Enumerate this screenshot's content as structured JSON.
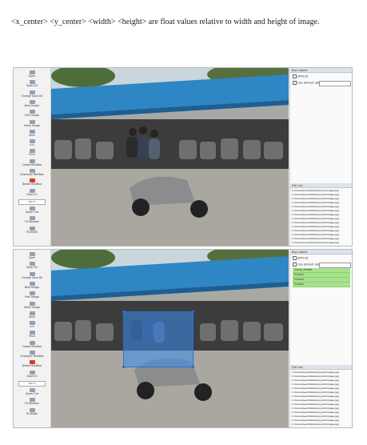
{
  "caption": "<x_center> <y_center> <width> <height> are float values relative to width and height of image.",
  "toolbar": {
    "items": [
      {
        "label": "Open",
        "icon": "folder-icon"
      },
      {
        "label": "Open Dir",
        "icon": "folder-open-icon"
      },
      {
        "label": "Change Save Dir",
        "icon": "folder-save-icon"
      },
      {
        "label": "Next Image",
        "icon": "arrow-right-icon"
      },
      {
        "label": "Prev Image",
        "icon": "arrow-left-icon"
      },
      {
        "label": "Verify Image",
        "icon": "verify-icon"
      },
      {
        "label": "Save",
        "icon": "save-icon"
      },
      {
        "label": "</>",
        "icon": "format-icon"
      },
      {
        "label": "YOLO",
        "icon": "yolo-icon"
      },
      {
        "label": "Create RectBox",
        "icon": "create-box-icon"
      },
      {
        "label": "Duplicate RectBox",
        "icon": "duplicate-box-icon"
      },
      {
        "label": "Delete RectBox",
        "icon": "delete-icon"
      },
      {
        "label": "Zoom In",
        "icon": "zoom-in-icon"
      }
    ],
    "zoom_value": "100 %",
    "bottom_items": [
      {
        "label": "Zoom Out",
        "icon": "zoom-out-icon"
      },
      {
        "label": "Fit Window",
        "icon": "fit-window-icon"
      },
      {
        "label": "Fit Width",
        "icon": "fit-width-icon"
      }
    ]
  },
  "panel": {
    "box_labels_title": "Box Labels",
    "edit_label": "Edit Label",
    "difficult": "difficult",
    "use_default_label": "Use default label",
    "file_list_title": "File List",
    "files": [
      "C:\\Users\\Asus\\Desktop\\yolo\\images.jpg",
      "C:\\Users\\Asus\\Desktop\\yolo\\images.jpg",
      "C:\\Users\\Asus\\Desktop\\yolo\\images.jpg",
      "C:\\Users\\Asus\\Desktop\\yolo\\images.jpg",
      "C:\\Users\\Asus\\Desktop\\yolo\\images.jpg",
      "C:\\Users\\Asus\\Desktop\\yolo\\images.jpg",
      "C:\\Users\\Asus\\Desktop\\yolo\\images.jpg",
      "C:\\Users\\Asus\\Desktop\\yolo\\images.jpg",
      "C:\\Users\\Asus\\Desktop\\yolo\\images.jpg",
      "C:\\Users\\Asus\\Desktop\\yolo\\images.jpg",
      "C:\\Users\\Asus\\Desktop\\yolo\\images.jpg",
      "C:\\Users\\Asus\\Desktop\\yolo\\images.jpg",
      "C:\\Users\\Asus\\Desktop\\yolo\\images.jpg",
      "C:\\Users\\Asus\\Desktop\\yolo\\images.jpg",
      "C:\\Users\\Asus\\Desktop\\yolo\\images.jpg",
      "C:\\Users\\Asus\\Desktop\\yolo\\images.jpg",
      "C:\\Users\\Asus\\Desktop\\yolo\\images.jpg",
      "C:\\Users\\Asus\\Desktop\\yolo\\images.jpg"
    ],
    "labels": [
      "Three_Seater",
      "Human",
      "Human",
      "Human"
    ]
  },
  "colors": {
    "roof": "#2f86c4",
    "selection_box": "#3c8cf0",
    "label_highlight": "#a9e28c",
    "delete_icon": "#d93a2b"
  }
}
